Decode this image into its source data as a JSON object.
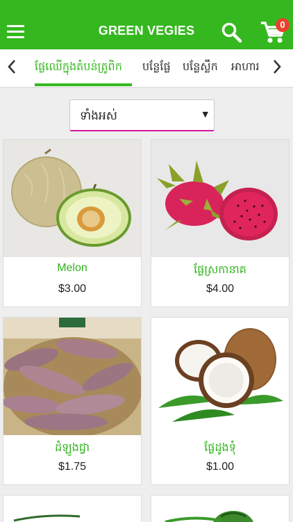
{
  "app": {
    "title": "GREEN VEGIES",
    "cart_count": "0",
    "brand_color": "#35b81f",
    "badge_color": "#e8412e"
  },
  "categories": [
    {
      "label": "ផ្លែឈើក្នុងតំបន់ត្រូពិក",
      "active": true
    },
    {
      "label": "បន្លែផ្លែ",
      "active": false
    },
    {
      "label": "បន្លែស្លឹក",
      "active": false
    },
    {
      "label": "អាហារ",
      "active": false
    }
  ],
  "filter": {
    "selected": "ទាំងអស់"
  },
  "products": [
    {
      "name": "Melon",
      "price": "$3.00",
      "image": "melon-image"
    },
    {
      "name": "ផ្លែស្រកានាគ",
      "price": "$4.00",
      "image": "dragon-fruit-image"
    },
    {
      "name": "ដំឡូងជ្វា",
      "price": "$1.75",
      "image": "sweet-potato-image"
    },
    {
      "name": "ផ្លែដូងទុំ",
      "price": "$1.00",
      "image": "coconut-image"
    }
  ]
}
